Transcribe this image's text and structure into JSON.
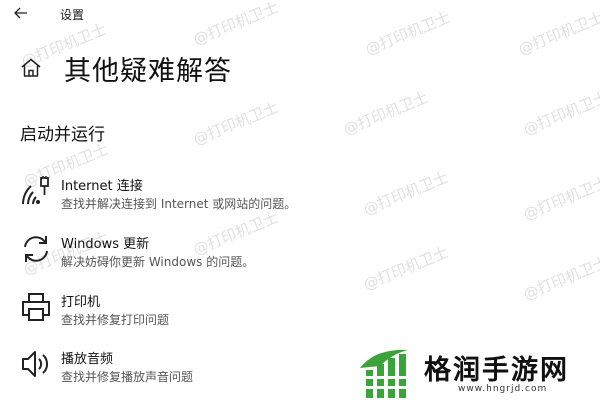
{
  "app": {
    "title": "设置"
  },
  "page": {
    "title": "其他疑难解答"
  },
  "section": {
    "heading": "启动并运行"
  },
  "items": [
    {
      "title": "Internet 连接",
      "desc": "查找并解决连接到 Internet 或网站的问题。",
      "icon": "wifi-icon"
    },
    {
      "title": "Windows 更新",
      "desc": "解决妨碍你更新 Windows 的问题。",
      "icon": "refresh-icon"
    },
    {
      "title": "打印机",
      "desc": "查找并修复打印问题",
      "icon": "printer-icon"
    },
    {
      "title": "播放音频",
      "desc": "查找并修复播放声音问题",
      "icon": "speaker-icon"
    }
  ],
  "watermark": {
    "text": "@打印机卫士"
  },
  "brand": {
    "name": "格润手游网",
    "url": "www.hngrjd.com",
    "accent": "#3aa33a"
  }
}
